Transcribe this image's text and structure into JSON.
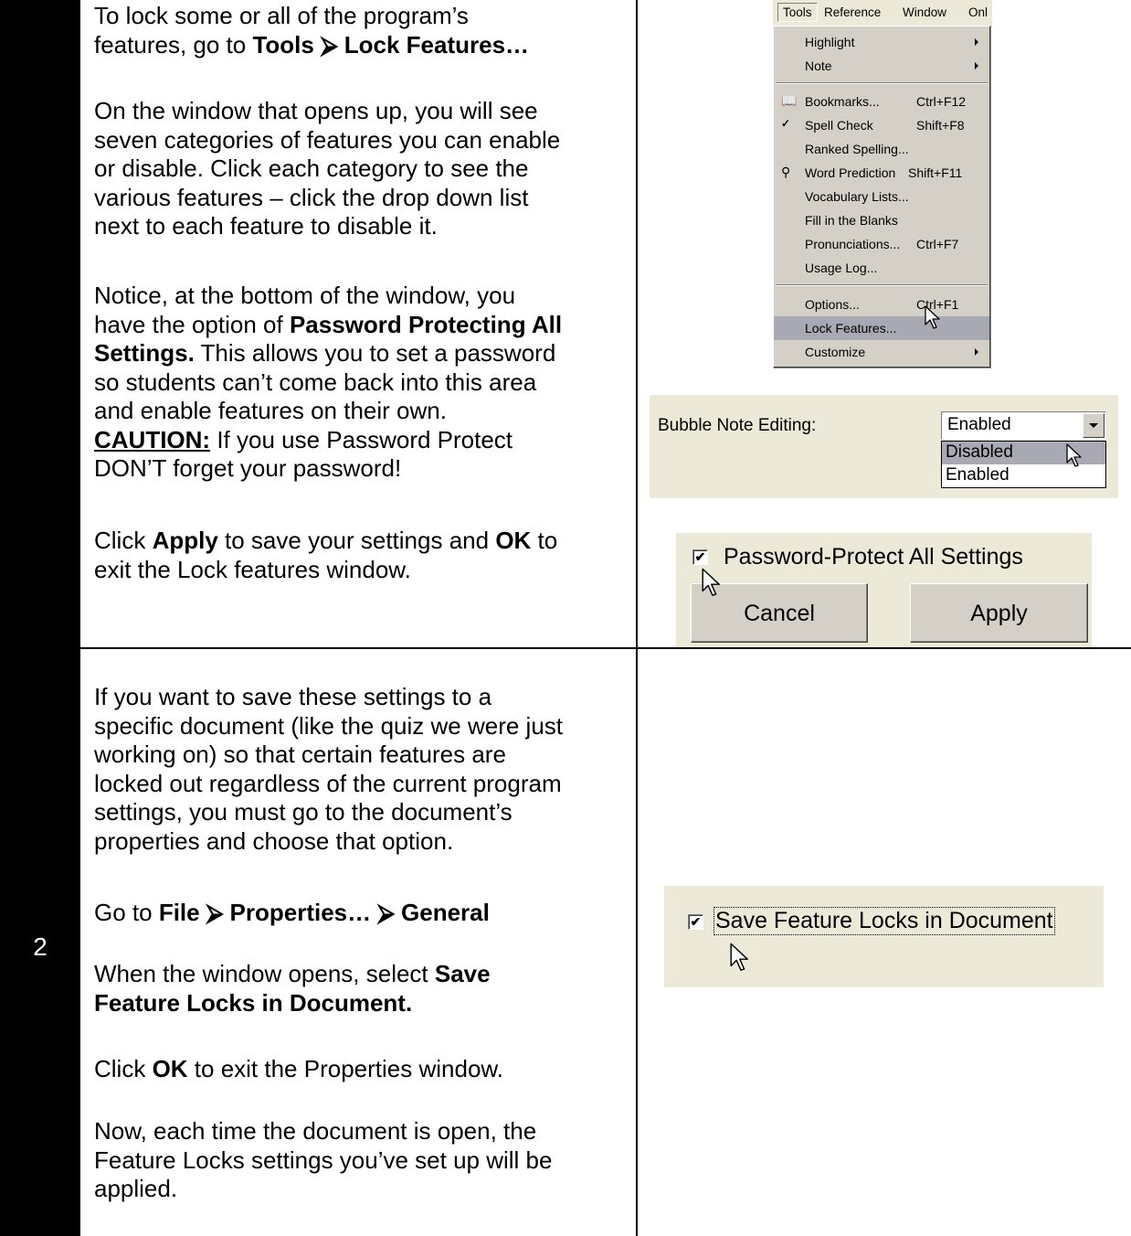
{
  "row1": {
    "para1": [
      "To lock some or all of the program’s",
      "features, go to "
    ],
    "para1_bold": "Tools ⮚ Lock Features…",
    "para2": [
      "On the window that opens up, you will see",
      "seven categories of features you can enable",
      "or disable.  Click each category to see the",
      "various features – click the drop down list",
      "next to each feature to disable it."
    ],
    "para3_a": [
      "Notice, at the bottom of the window, you",
      "have the option of "
    ],
    "para3_bold1": "Password Protecting All",
    "para3_bold2": "Settings.",
    "para3_b": [
      "  This allows you to set a password",
      "so students can’t come back into this area",
      "and enable features on their own."
    ],
    "caution": "CAUTION:",
    "caution_rest": " If you use Password Protect",
    "caution_line2": "DON’T forget your password!",
    "para4_a": "Click ",
    "para4_apply": "Apply",
    "para4_b": " to save your settings and ",
    "para4_ok": "OK",
    "para4_c": " to",
    "para4_line2": "exit the Lock features window."
  },
  "menu": {
    "bar": [
      "Tools",
      "Reference",
      "Window",
      "Onl"
    ],
    "items": [
      {
        "label": "Highlight",
        "shortcut": "",
        "submenu": true,
        "icon": ""
      },
      {
        "label": "Note",
        "shortcut": "",
        "submenu": true,
        "icon": ""
      },
      {
        "label": "Bookmarks...",
        "shortcut": "Ctrl+F12",
        "submenu": false,
        "icon": "book-icon"
      },
      {
        "label": "Spell Check",
        "shortcut": "Shift+F8",
        "submenu": false,
        "icon": "spell-check-icon"
      },
      {
        "label": "Ranked Spelling...",
        "shortcut": "",
        "submenu": false,
        "icon": ""
      },
      {
        "label": "Word Prediction",
        "shortcut": "Shift+F11",
        "submenu": false,
        "icon": "word-prediction-icon"
      },
      {
        "label": "Vocabulary Lists...",
        "shortcut": "",
        "submenu": false,
        "icon": ""
      },
      {
        "label": "Fill in the Blanks",
        "shortcut": "",
        "submenu": false,
        "icon": ""
      },
      {
        "label": "Pronunciations...",
        "shortcut": "Ctrl+F7",
        "submenu": false,
        "icon": ""
      },
      {
        "label": "Usage Log...",
        "shortcut": "",
        "submenu": false,
        "icon": ""
      },
      {
        "label": "Options...",
        "shortcut": "Ctrl+F1",
        "submenu": false,
        "icon": ""
      },
      {
        "label": "Lock Features...",
        "shortcut": "",
        "submenu": false,
        "icon": ""
      },
      {
        "label": "Customize",
        "shortcut": "",
        "submenu": true,
        "icon": ""
      }
    ]
  },
  "dropdown": {
    "label": "Bubble Note Editing:",
    "value": "Enabled",
    "options": [
      "Disabled",
      "Enabled"
    ]
  },
  "password": {
    "checkbox_label": "Password-Protect All Settings",
    "checked": true,
    "cancel_label": "Cancel",
    "apply_label": "Apply"
  },
  "row2": {
    "step_number": "2",
    "para1": [
      "If you want to save these settings to a",
      "specific document (like the quiz we were just",
      "working on) so that certain features are",
      "locked out regardless of the current program",
      "settings, you must go to the document’s",
      "properties and choose that option."
    ],
    "para2_a": "Go to ",
    "para2_bold": "File ⮚ Properties… ⮚ General",
    "para3_a": "When the window opens, select ",
    "para3_bold1": "Save",
    "para3_bold2": "Feature Locks in Document.",
    "para4_a": "Click ",
    "para4_ok": "OK",
    "para4_b": " to exit the Properties window.",
    "para5": [
      "Now, each time the document is open, the",
      "Feature Locks settings you’ve set up will be",
      "applied."
    ]
  },
  "save_locks": {
    "checkbox_label": "Save Feature Locks in Document",
    "checked": true
  }
}
